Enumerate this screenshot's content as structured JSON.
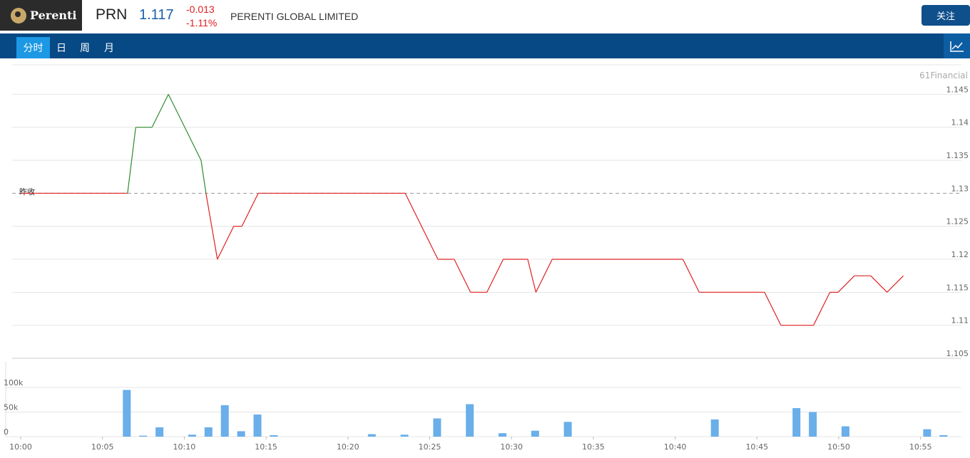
{
  "header": {
    "logo_text": "Perenti",
    "ticker": "PRN",
    "price": "1.117",
    "change": "-0.013",
    "change_pct": "-1.11%",
    "company": "PERENTI GLOBAL LIMITED",
    "follow_label": "关注"
  },
  "tabs": [
    "分时",
    "日",
    "周",
    "月"
  ],
  "watermark": "61Financial",
  "prev_close_label": "昨收",
  "colors": {
    "up": "#2e8b2e",
    "down": "#e02020",
    "volume": "#6aaeea",
    "accent": "#064985"
  },
  "icons": {
    "chart_toggle": "line-chart-icon"
  },
  "chart_data": {
    "type": "line",
    "prev_close": 1.13,
    "ylim": [
      1.105,
      1.15
    ],
    "y_ticks": [
      "1.145",
      "1.14",
      "1.135",
      "1.13",
      "1.125",
      "1.12",
      "1.115",
      "1.11",
      "1.105"
    ],
    "x_ticks": [
      "10:00",
      "10:05",
      "10:10",
      "10:15",
      "10:20",
      "10:25",
      "10:30",
      "10:35",
      "10:40",
      "10:45",
      "10:50",
      "10:55"
    ],
    "price_series": [
      [
        0,
        1.13
      ],
      [
        6.5,
        1.13
      ],
      [
        7,
        1.14
      ],
      [
        8,
        1.14
      ],
      [
        9,
        1.145
      ],
      [
        11,
        1.135
      ],
      [
        11.3,
        1.13
      ],
      [
        12,
        1.12
      ],
      [
        13,
        1.125
      ],
      [
        13.5,
        1.125
      ],
      [
        14.5,
        1.13
      ],
      [
        23.5,
        1.13
      ],
      [
        25.5,
        1.12
      ],
      [
        26.5,
        1.12
      ],
      [
        27.5,
        1.115
      ],
      [
        28.5,
        1.115
      ],
      [
        29.5,
        1.12
      ],
      [
        31,
        1.12
      ],
      [
        31.5,
        1.115
      ],
      [
        32.5,
        1.12
      ],
      [
        40.5,
        1.12
      ],
      [
        41.5,
        1.115
      ],
      [
        45.5,
        1.115
      ],
      [
        46.5,
        1.11
      ],
      [
        48.5,
        1.11
      ],
      [
        49.5,
        1.115
      ],
      [
        50,
        1.115
      ],
      [
        51,
        1.1175
      ],
      [
        52,
        1.1175
      ],
      [
        53,
        1.115
      ],
      [
        54,
        1.1175
      ]
    ],
    "volume_ylabels": [
      "100k",
      "50k",
      "0"
    ],
    "volume_ylim": [
      0,
      100000
    ],
    "volume_series": [
      [
        7,
        95000
      ],
      [
        8,
        2000
      ],
      [
        9,
        19000
      ],
      [
        11,
        4000
      ],
      [
        12,
        19000
      ],
      [
        13,
        64000
      ],
      [
        14,
        11000
      ],
      [
        15,
        45000
      ],
      [
        16,
        3000
      ],
      [
        22,
        5000
      ],
      [
        24,
        4000
      ],
      [
        26,
        37000
      ],
      [
        28,
        66000
      ],
      [
        30,
        7000
      ],
      [
        32,
        12000
      ],
      [
        34,
        30000
      ],
      [
        43,
        35000
      ],
      [
        48,
        58000
      ],
      [
        49,
        50000
      ],
      [
        51,
        21000
      ],
      [
        56,
        15000
      ],
      [
        57,
        3000
      ]
    ]
  }
}
